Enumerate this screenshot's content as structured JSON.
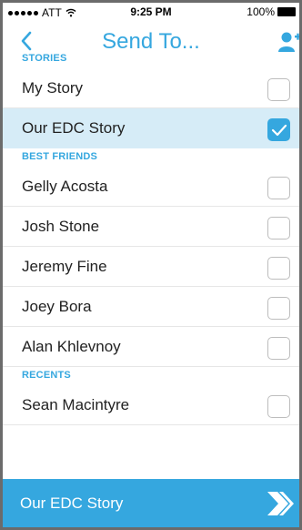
{
  "status_bar": {
    "carrier": "ATT",
    "time": "9:25 PM",
    "battery": "100%"
  },
  "nav": {
    "title": "Send To..."
  },
  "sections": [
    {
      "title": "STORIES",
      "rows": [
        {
          "label": "My Story",
          "checked": false
        },
        {
          "label": "Our EDC Story",
          "checked": true
        }
      ]
    },
    {
      "title": "BEST FRIENDS",
      "rows": [
        {
          "label": "Gelly Acosta",
          "checked": false
        },
        {
          "label": "Josh Stone",
          "checked": false
        },
        {
          "label": "Jeremy Fine",
          "checked": false
        },
        {
          "label": "Joey Bora",
          "checked": false
        },
        {
          "label": "Alan Khlevnoy",
          "checked": false
        }
      ]
    },
    {
      "title": "RECENTS",
      "rows": [
        {
          "label": "Sean Macintyre",
          "checked": false
        }
      ]
    }
  ],
  "bottom_bar": {
    "selected_label": "Our EDC Story"
  },
  "colors": {
    "accent": "#35a7df",
    "selected_row": "#d6ecf7"
  },
  "icons": {
    "back": "chevron-left-icon",
    "add_user": "add-user-icon",
    "send": "double-chevron-right-icon",
    "check": "checkmark-icon"
  }
}
